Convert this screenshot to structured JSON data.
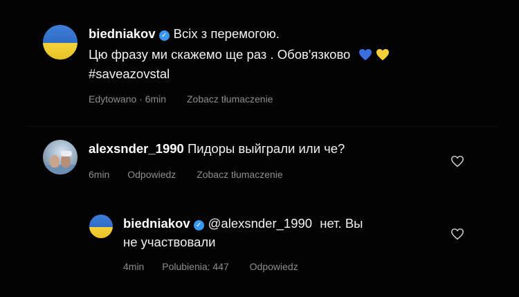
{
  "colors": {
    "background": "#030303",
    "text": "#f2f2f2",
    "meta_text": "#8e8e8e",
    "verified_badge": "#3897f0",
    "flag_blue": "#3572cc",
    "flag_yellow": "#f0cc30"
  },
  "comments": [
    {
      "username": "biedniakov",
      "verified": true,
      "avatar": "ukraine-flag-avatar",
      "text_line1": "Всіх з перемогою.",
      "text_line2": "Цю фразу ми скажемо ще раз . Обов'язково",
      "emojis": [
        "blue-heart-emoji",
        "yellow-heart-emoji"
      ],
      "hashtag": "#saveazovstal",
      "meta": {
        "edited": "Edytowano",
        "separator": "·",
        "time": "6min",
        "translate": "Zobacz tłumaczenie"
      }
    },
    {
      "username": "alexsnder_1990",
      "verified": false,
      "avatar": "photo-avatar",
      "text": "Пидоры выйграли или че?",
      "meta": {
        "time": "6min",
        "reply": "Odpowiedz",
        "translate": "Zobacz tłumaczenie"
      },
      "icon": "heart-outline-icon"
    },
    {
      "username": "biedniakov",
      "verified": true,
      "avatar": "ukraine-flag-avatar",
      "mention": "@alexsnder_1990",
      "text_rest": "нет. Вы",
      "text_line2": "не участвовали",
      "meta": {
        "time": "4min",
        "likes": "Polubienia: 447",
        "reply": "Odpowiedz"
      },
      "icon": "heart-outline-icon"
    }
  ]
}
